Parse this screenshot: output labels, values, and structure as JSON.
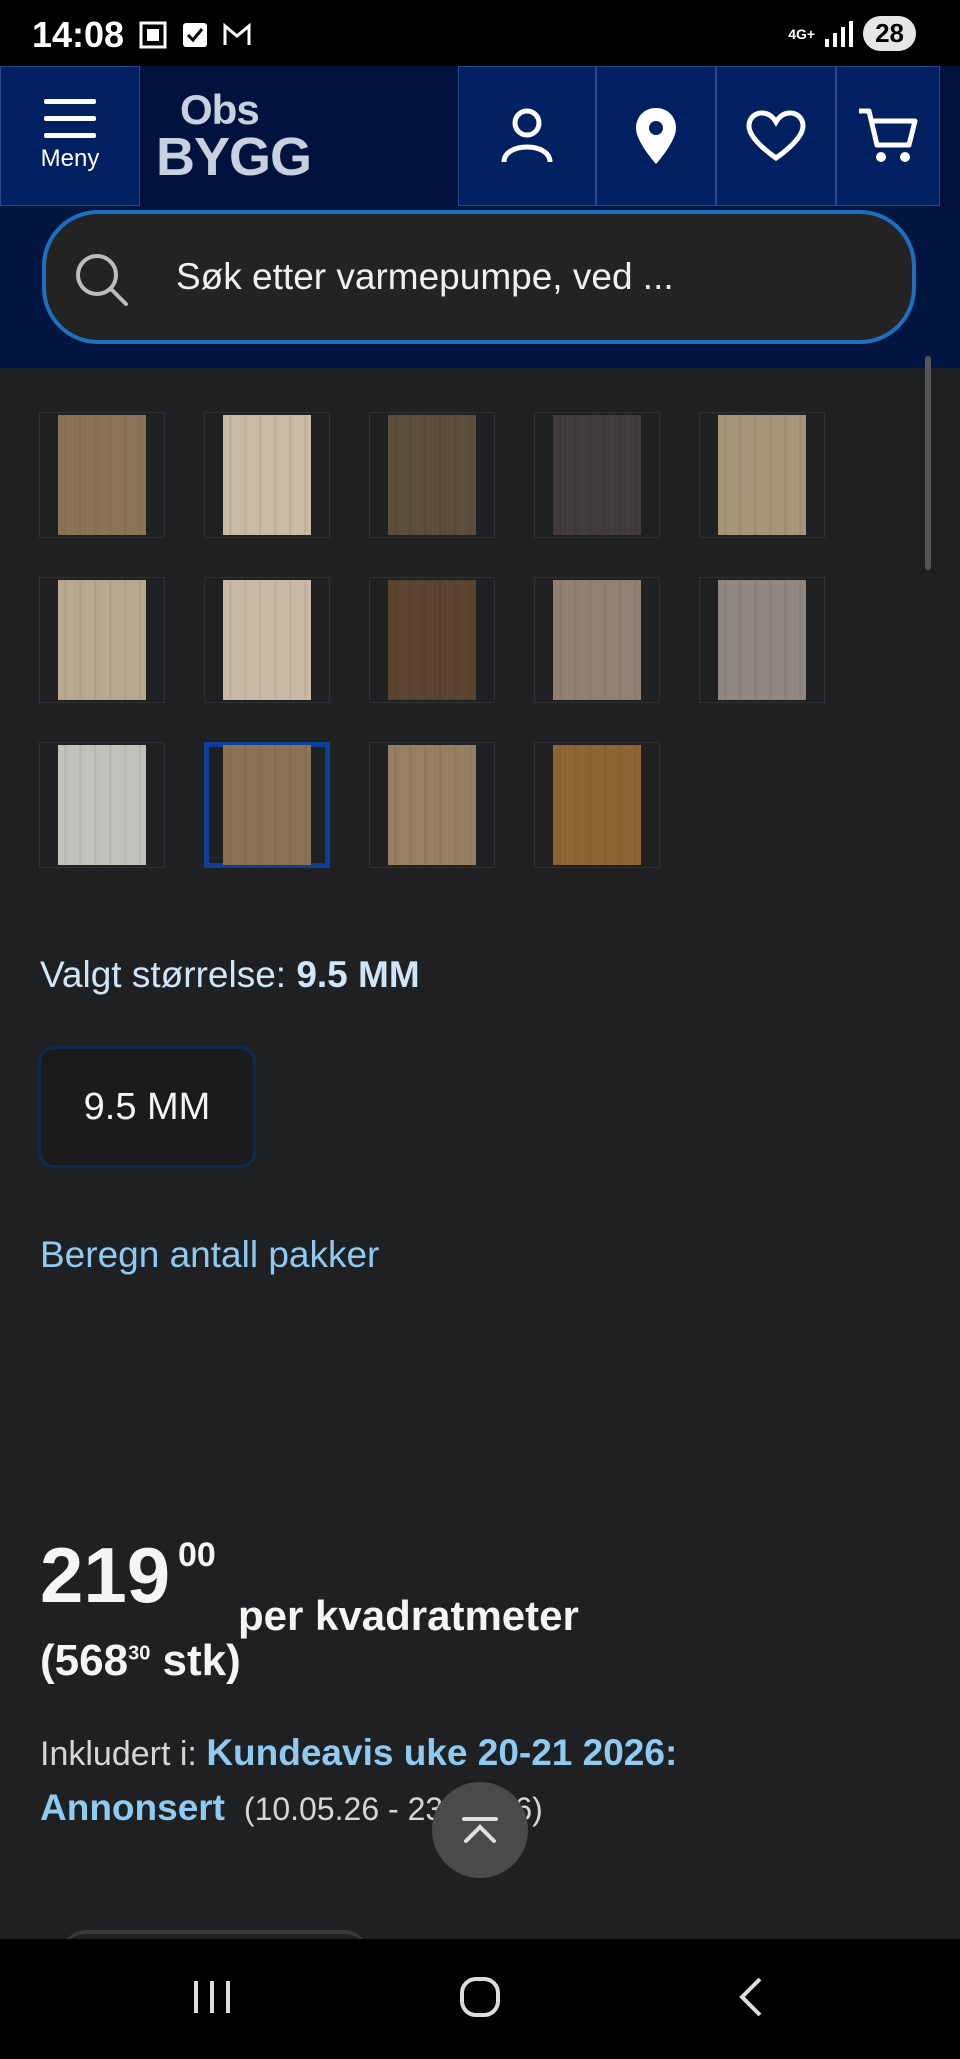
{
  "status_bar": {
    "time": "14:08",
    "network": "4G+",
    "battery": "28"
  },
  "header": {
    "menu_label": "Meny",
    "logo_line1": "Obs",
    "logo_line2": "BYGG",
    "icons": [
      "user-icon",
      "location-pin-icon",
      "heart-icon",
      "cart-icon"
    ],
    "brand_color": "#002062"
  },
  "search": {
    "placeholder": "Søk etter varmepumpe, ved ..."
  },
  "swatches": [
    {
      "color": "#8a7257"
    },
    {
      "color": "#c9bba4"
    },
    {
      "color": "#5e4c3c"
    },
    {
      "color": "#3f3c3b"
    },
    {
      "color": "#a89478"
    },
    {
      "color": "#b7a990"
    },
    {
      "color": "#c7baa5"
    },
    {
      "color": "#5c4530"
    },
    {
      "color": "#8f8073"
    },
    {
      "color": "#8f8780"
    },
    {
      "color": "#c2c2bd"
    },
    {
      "color": "#8b7154",
      "selected": true
    },
    {
      "color": "#977f62"
    },
    {
      "color": "#8f6434"
    }
  ],
  "size": {
    "label": "Valgt størrelse: ",
    "value": "9.5 MM",
    "option": "9.5 MM"
  },
  "calc_link": "Beregn antall pakker",
  "price": {
    "integer": "219",
    "decimals": "00",
    "unit": "per kvadratmeter",
    "per_piece_open": "(568",
    "per_piece_dec": "30",
    "per_piece_close": " stk)"
  },
  "included": {
    "label": "Inkludert i: ",
    "campaign_line1": "Kundeavis uke 20-21 2026:",
    "campaign_line2": "Annonsert",
    "dates": "(10.05.26 - 23.05.26)"
  }
}
